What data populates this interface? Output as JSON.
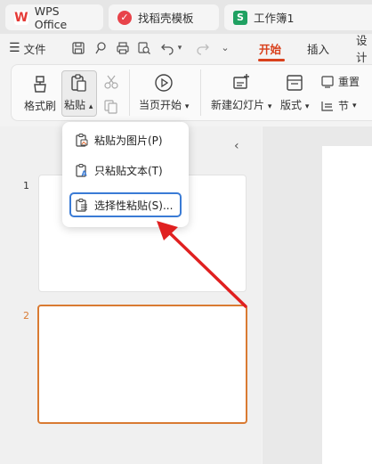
{
  "tabs": [
    {
      "label": "WPS Office"
    },
    {
      "label": "找稻壳模板"
    },
    {
      "label": "工作簿1",
      "badge": "S"
    }
  ],
  "menu": {
    "file": "文件",
    "start": "开始",
    "insert": "插入",
    "design": "设计"
  },
  "ribbon": {
    "format_brush": "格式刷",
    "paste": "粘贴",
    "from_start": "当页开始",
    "new_slide": "新建幻灯片",
    "layout": "版式",
    "reset": "重置",
    "section": "节"
  },
  "slides": [
    {
      "number": "1"
    },
    {
      "number": "2"
    }
  ],
  "paste_menu": {
    "items": [
      {
        "label": "粘贴为图片(P)"
      },
      {
        "label": "只粘贴文本(T)"
      },
      {
        "label": "选择性粘贴(S)..."
      }
    ]
  },
  "colors": {
    "accent": "#d9401c",
    "selection": "#d97a32",
    "highlight": "#3a7bd5",
    "arrow": "#e02020"
  }
}
